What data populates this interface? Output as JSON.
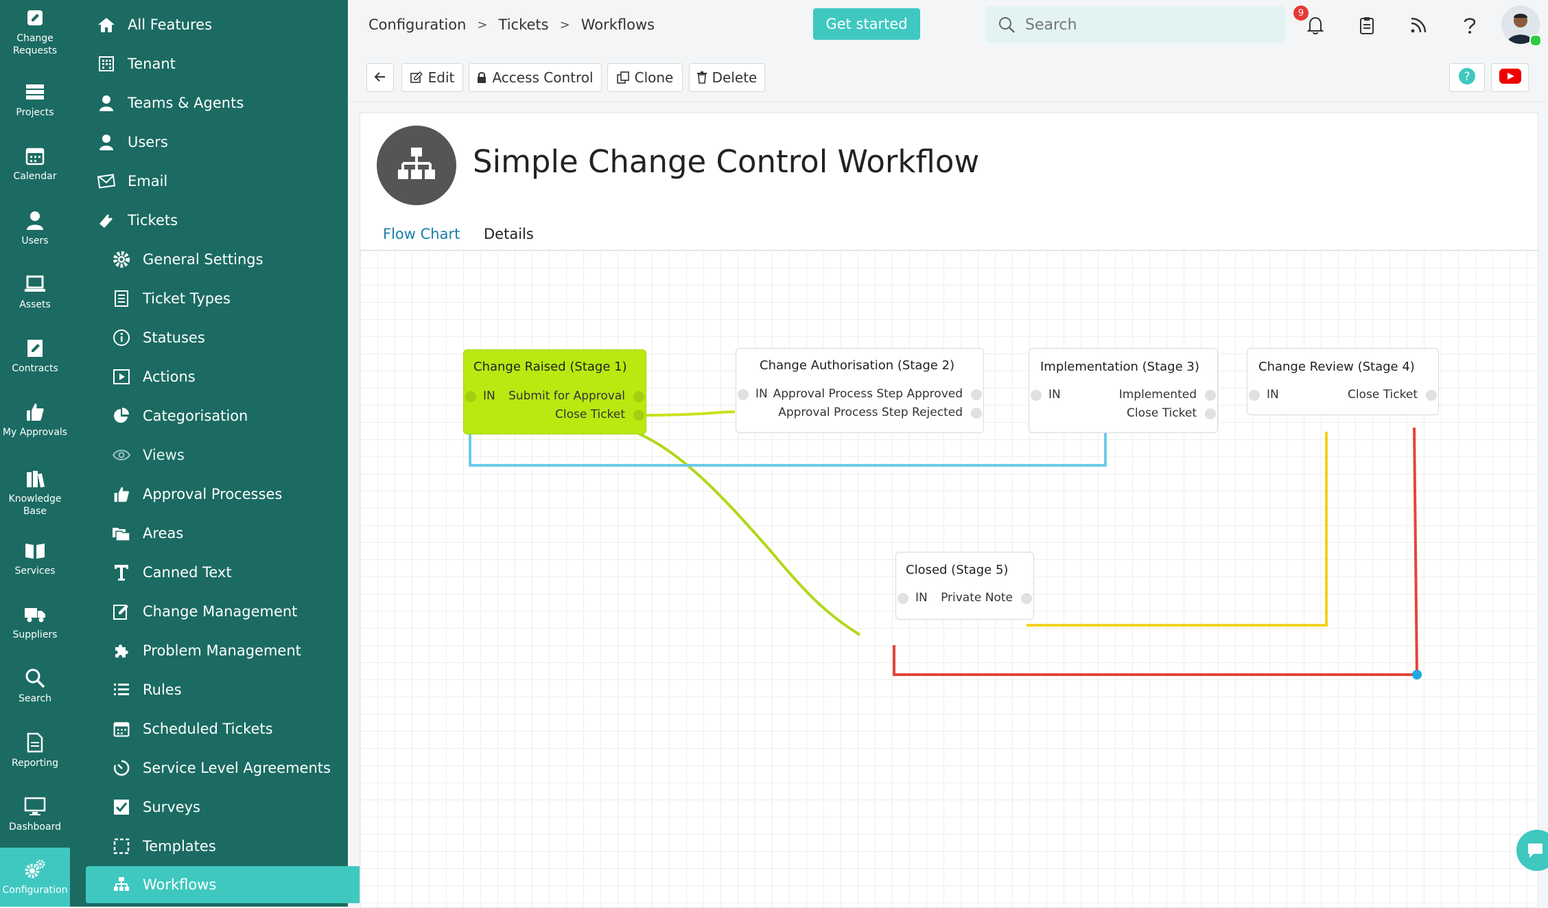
{
  "rail": [
    {
      "label": "Change Requests",
      "icon": "edit-icon"
    },
    {
      "label": "Projects",
      "icon": "layers-icon"
    },
    {
      "label": "Calendar",
      "icon": "calendar-icon"
    },
    {
      "label": "Users",
      "icon": "user-icon"
    },
    {
      "label": "Assets",
      "icon": "laptop-icon"
    },
    {
      "label": "Contracts",
      "icon": "contract-icon"
    },
    {
      "label": "My Approvals",
      "icon": "thumbs-up-icon"
    },
    {
      "label": "Knowledge Base",
      "icon": "books-icon"
    },
    {
      "label": "Services",
      "icon": "book-open-icon"
    },
    {
      "label": "Suppliers",
      "icon": "truck-icon"
    },
    {
      "label": "Search",
      "icon": "search-icon"
    },
    {
      "label": "Reporting",
      "icon": "report-icon"
    },
    {
      "label": "Dashboard",
      "icon": "monitor-icon"
    },
    {
      "label": "Configuration",
      "icon": "gears-icon"
    }
  ],
  "sidebar": [
    {
      "label": "All Features",
      "icon": "home-icon",
      "level": 1
    },
    {
      "label": "Tenant",
      "icon": "building-icon",
      "level": 1
    },
    {
      "label": "Teams & Agents",
      "icon": "agent-icon",
      "level": 1
    },
    {
      "label": "Users",
      "icon": "user-icon",
      "level": 1
    },
    {
      "label": "Email",
      "icon": "envelope-icon",
      "level": 1
    },
    {
      "label": "Tickets",
      "icon": "ticket-icon",
      "level": 1
    },
    {
      "label": "General Settings",
      "icon": "gear-icon",
      "level": 2
    },
    {
      "label": "Ticket Types",
      "icon": "list-doc-icon",
      "level": 2
    },
    {
      "label": "Statuses",
      "icon": "info-icon",
      "level": 2
    },
    {
      "label": "Actions",
      "icon": "play-icon",
      "level": 2
    },
    {
      "label": "Categorisation",
      "icon": "pie-icon",
      "level": 2
    },
    {
      "label": "Views",
      "icon": "eye-icon",
      "level": 2
    },
    {
      "label": "Approval Processes",
      "icon": "thumbs-up-icon",
      "level": 2
    },
    {
      "label": "Areas",
      "icon": "folders-icon",
      "level": 2
    },
    {
      "label": "Canned Text",
      "icon": "text-icon",
      "level": 2
    },
    {
      "label": "Change Management",
      "icon": "edit-doc-icon",
      "level": 2
    },
    {
      "label": "Problem Management",
      "icon": "puzzle-icon",
      "level": 2
    },
    {
      "label": "Rules",
      "icon": "list-icon",
      "level": 2
    },
    {
      "label": "Scheduled Tickets",
      "icon": "calendar-icon",
      "level": 2
    },
    {
      "label": "Service Level Agreements",
      "icon": "timer-icon",
      "level": 2
    },
    {
      "label": "Surveys",
      "icon": "checkbox-icon",
      "level": 2
    },
    {
      "label": "Templates",
      "icon": "dashed-square-icon",
      "level": 2
    },
    {
      "label": "Workflows",
      "icon": "sitemap-icon",
      "level": 2
    }
  ],
  "breadcrumbs": [
    "Configuration",
    "Tickets",
    "Workflows"
  ],
  "header": {
    "get_started": "Get started",
    "search_placeholder": "Search",
    "notification_count": "9"
  },
  "toolbar": {
    "edit": "Edit",
    "access_control": "Access Control",
    "clone": "Clone",
    "delete": "Delete"
  },
  "workflow": {
    "title": "Simple Change Control Workflow",
    "tabs": [
      "Flow Chart",
      "Details"
    ],
    "active_tab": "Flow Chart"
  },
  "flowchart": {
    "nodes": [
      {
        "title": "Change Raised (Stage 1)",
        "in": "IN",
        "outputs": [
          "Submit for Approval",
          "Close Ticket"
        ],
        "highlighted": true
      },
      {
        "title": "Change Authorisation (Stage 2)",
        "in": "IN",
        "outputs": [
          "Approval Process Step Approved",
          "Approval Process Step Rejected"
        ],
        "highlighted": false
      },
      {
        "title": "Implementation (Stage 3)",
        "in": "IN",
        "outputs": [
          "Implemented",
          "Close Ticket"
        ],
        "highlighted": false
      },
      {
        "title": "Change Review (Stage 4)",
        "in": "IN",
        "outputs": [
          "Close Ticket"
        ],
        "highlighted": false
      },
      {
        "title": "Closed (Stage 5)",
        "in": "IN",
        "outputs": [
          "Private Note"
        ],
        "highlighted": false
      }
    ],
    "link_colors": {
      "yellow_green": "#c8e21a",
      "blue": "#6ccbe8",
      "orange": "#f2a22b",
      "yellow": "#f2d21f",
      "red": "#e2463a"
    }
  },
  "colors": {
    "brand": "#1b6b62",
    "accent": "#3ec8c0",
    "link": "#1a7fa8"
  }
}
